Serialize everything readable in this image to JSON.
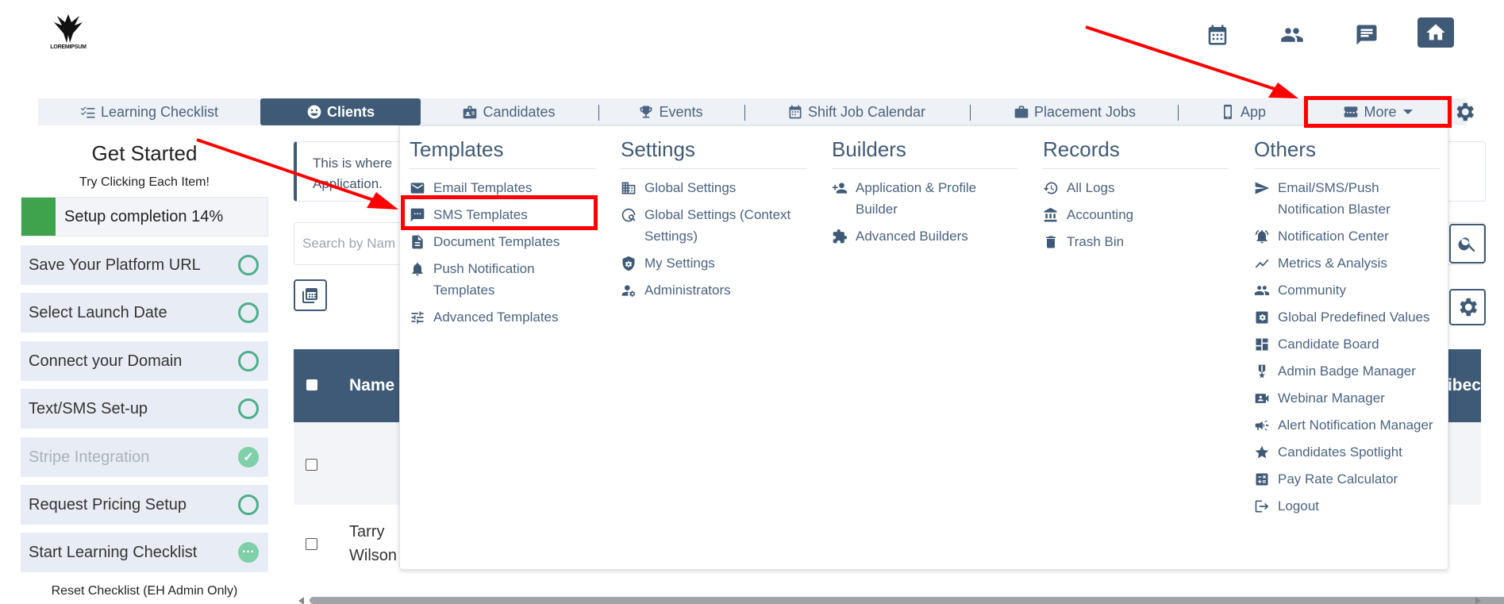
{
  "brand": {
    "logo_text": "LOREMIPSUM"
  },
  "header": {
    "icons": [
      "calendar-icon",
      "people-icon",
      "chat-icon",
      "home-icon"
    ]
  },
  "nav": {
    "items": [
      {
        "label": "Learning Checklist",
        "icon": "checklist-icon"
      },
      {
        "label": "Clients",
        "icon": "face-icon",
        "active": true
      },
      {
        "label": "Candidates",
        "icon": "id-badge-icon"
      },
      {
        "label": "Events",
        "icon": "trophy-icon"
      },
      {
        "label": "Shift Job Calendar",
        "icon": "calendar-icon"
      },
      {
        "label": "Placement Jobs",
        "icon": "briefcase-icon"
      },
      {
        "label": "App",
        "icon": "phone-icon"
      },
      {
        "label": "More",
        "icon": "ticket-icon"
      }
    ]
  },
  "sidebar": {
    "title": "Get Started",
    "subtitle": "Try Clicking Each Item!",
    "progress_label": "Setup completion 14%",
    "progress_value": 0.14,
    "items": [
      {
        "label": "Save Your Platform URL",
        "status": "open"
      },
      {
        "label": "Select Launch Date",
        "status": "open"
      },
      {
        "label": "Connect your Domain",
        "status": "open"
      },
      {
        "label": "Text/SMS Set-up",
        "status": "open"
      },
      {
        "label": "Stripe Integration",
        "status": "done",
        "glyph": "✓"
      },
      {
        "label": "Request Pricing Setup",
        "status": "open"
      },
      {
        "label": "Start Learning Checklist",
        "status": "in-progress",
        "glyph": "···"
      }
    ],
    "reset_label": "Reset Checklist (EH Admin Only)"
  },
  "content": {
    "info_line1": "This is where",
    "info_line2": "Application.",
    "search_placeholder": "Search by Nam",
    "table": {
      "col_name": "Name",
      "col_right": "ribec",
      "row_name_line1": "Tarry",
      "row_name_line2": "Wilson"
    }
  },
  "menu": {
    "columns": [
      {
        "title": "Templates",
        "items": [
          {
            "label": "Email Templates",
            "icon": "envelope-icon"
          },
          {
            "label": "SMS Templates",
            "icon": "sms-icon"
          },
          {
            "label": "Document Templates",
            "icon": "document-icon"
          },
          {
            "label": "Push Notification Templates",
            "icon": "bell-icon"
          },
          {
            "label": "Advanced Templates",
            "icon": "sliders-icon"
          }
        ]
      },
      {
        "title": "Settings",
        "items": [
          {
            "label": "Global Settings",
            "icon": "building-icon"
          },
          {
            "label": "Global Settings (Context Settings)",
            "icon": "globe-search-icon"
          },
          {
            "label": "My Settings",
            "icon": "shield-gear-icon"
          },
          {
            "label": "Administrators",
            "icon": "user-gear-icon"
          }
        ]
      },
      {
        "title": "Builders",
        "items": [
          {
            "label": "Application & Profile Builder",
            "icon": "person-add-icon"
          },
          {
            "label": "Advanced Builders",
            "icon": "puzzle-icon"
          }
        ]
      },
      {
        "title": "Records",
        "items": [
          {
            "label": "All Logs",
            "icon": "history-icon"
          },
          {
            "label": "Accounting",
            "icon": "bank-icon"
          },
          {
            "label": "Trash Bin",
            "icon": "trash-icon"
          }
        ]
      },
      {
        "title": "Others",
        "items": [
          {
            "label": "Email/SMS/Push Notification Blaster",
            "icon": "send-icon"
          },
          {
            "label": "Notification Center",
            "icon": "alarm-bell-icon"
          },
          {
            "label": "Metrics & Analysis",
            "icon": "trend-icon"
          },
          {
            "label": "Community",
            "icon": "people-icon"
          },
          {
            "label": "Global Predefined Values",
            "icon": "settings-box-icon"
          },
          {
            "label": "Candidate Board",
            "icon": "dashboard-icon"
          },
          {
            "label": "Admin Badge Manager",
            "icon": "medal-icon"
          },
          {
            "label": "Webinar Manager",
            "icon": "video-call-icon"
          },
          {
            "label": "Alert Notification Manager",
            "icon": "megaphone-icon"
          },
          {
            "label": "Candidates Spotlight",
            "icon": "star-icon"
          },
          {
            "label": "Pay Rate Calculator",
            "icon": "calculator-icon"
          },
          {
            "label": "Logout",
            "icon": "logout-icon"
          }
        ]
      }
    ]
  },
  "colors": {
    "primary": "#3f5a76",
    "progress": "#3fa34d",
    "highlight": "#ff0000",
    "success": "#4caf8a"
  }
}
